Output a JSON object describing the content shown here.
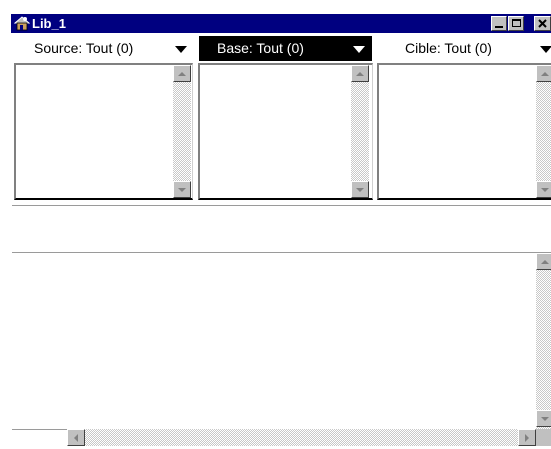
{
  "window": {
    "title": "Lib_1",
    "icon": "app-window-icon",
    "controls": [
      "minimize-icon",
      "maximize-icon",
      "close-icon"
    ],
    "titlebar_color": "#000080"
  },
  "filters": [
    {
      "label": "Source: Tout (0)",
      "active": false
    },
    {
      "label": "Base: Tout (0)",
      "active": true
    },
    {
      "label": "Cible: Tout (0)",
      "active": false
    }
  ],
  "status_field": {
    "value": ""
  },
  "colors": {
    "active_header_bg": "#000000",
    "active_header_text": "#ffffff"
  }
}
